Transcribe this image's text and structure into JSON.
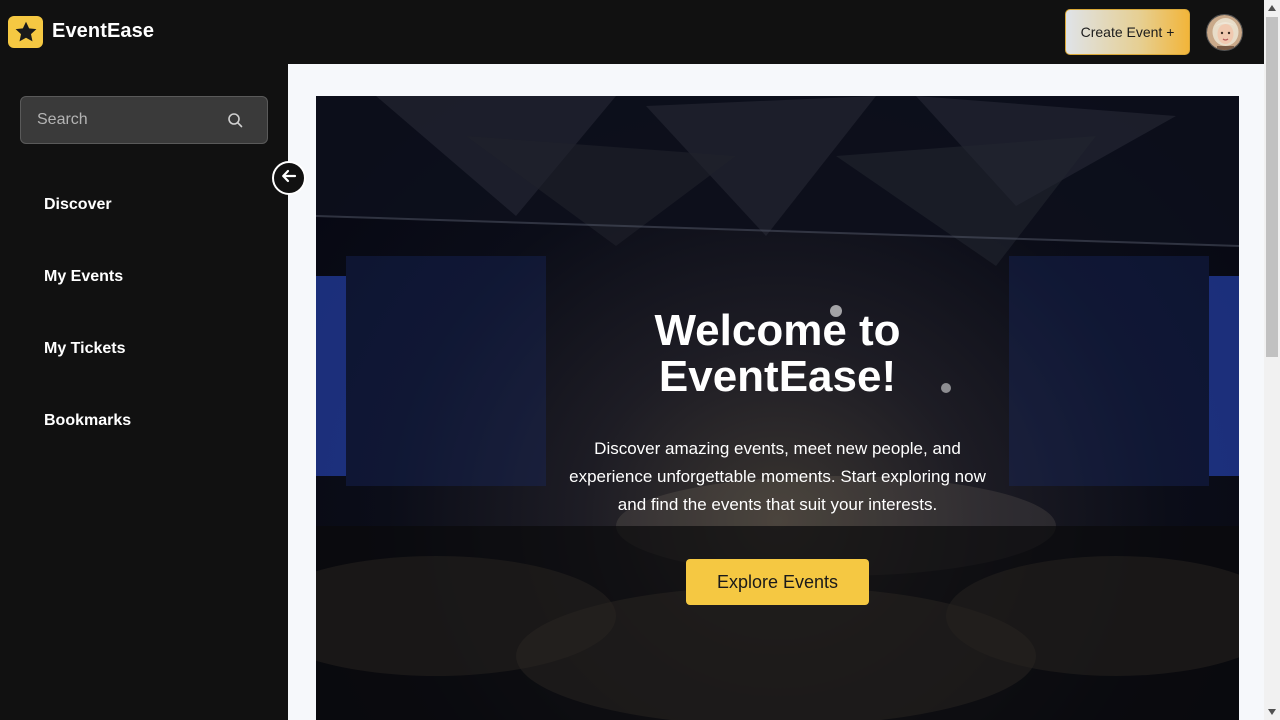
{
  "app": {
    "name": "EventEase",
    "logo_icon": "star-icon",
    "accent_color": "#f5c842"
  },
  "header": {
    "create_event_label": "Create Event +",
    "avatar_icon": "user-avatar"
  },
  "sidebar": {
    "search": {
      "placeholder": "Search",
      "value": "",
      "icon": "search-icon"
    },
    "collapse_icon": "arrow-left-icon",
    "items": [
      {
        "label": "Discover"
      },
      {
        "label": "My Events"
      },
      {
        "label": "My Tickets"
      },
      {
        "label": "Bookmarks"
      }
    ]
  },
  "hero": {
    "title_line1": "Welcome to",
    "title_line2": "EventEase!",
    "subtitle_line1": "Discover amazing events, meet new people, and",
    "subtitle_line2": "experience unforgettable moments. Start exploring now",
    "subtitle_line3": "and find the events that suit your interests.",
    "cta_label": "Explore Events"
  }
}
